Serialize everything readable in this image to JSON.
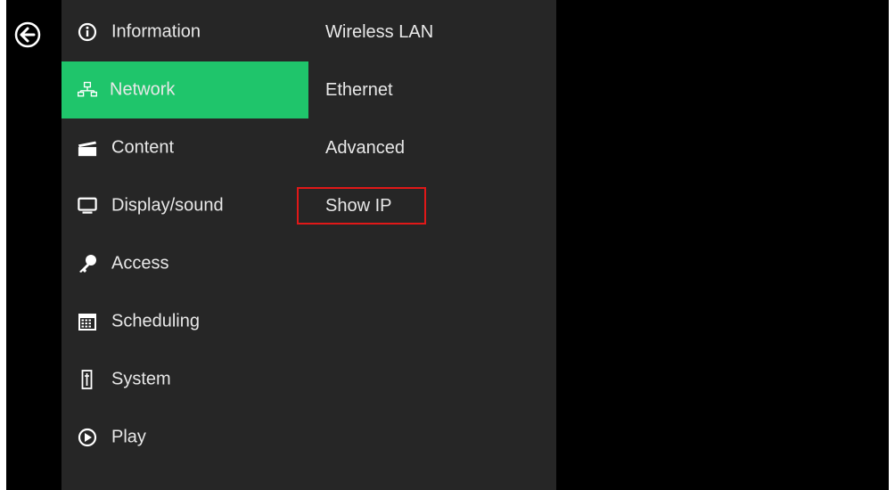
{
  "back_button": {
    "icon": "back-arrow-icon"
  },
  "menu": {
    "items": [
      {
        "label": "Information",
        "icon": "info-icon",
        "active": false
      },
      {
        "label": "Network",
        "icon": "network-icon",
        "active": true
      },
      {
        "label": "Content",
        "icon": "clapperboard-icon",
        "active": false
      },
      {
        "label": "Display/sound",
        "icon": "monitor-icon",
        "active": false
      },
      {
        "label": "Access",
        "icon": "key-icon",
        "active": false
      },
      {
        "label": "Scheduling",
        "icon": "calendar-icon",
        "active": false
      },
      {
        "label": "System",
        "icon": "system-icon",
        "active": false
      },
      {
        "label": "Play",
        "icon": "play-icon",
        "active": false
      }
    ]
  },
  "submenu": {
    "items": [
      {
        "label": "Wireless LAN"
      },
      {
        "label": "Ethernet"
      },
      {
        "label": "Advanced"
      },
      {
        "label": "Show IP"
      }
    ],
    "highlighted": "Show IP"
  },
  "colors": {
    "accent": "#1fc56b",
    "panel": "#262626",
    "background": "#000000",
    "highlight_border": "#e01818",
    "text": "#e8e8e8"
  }
}
